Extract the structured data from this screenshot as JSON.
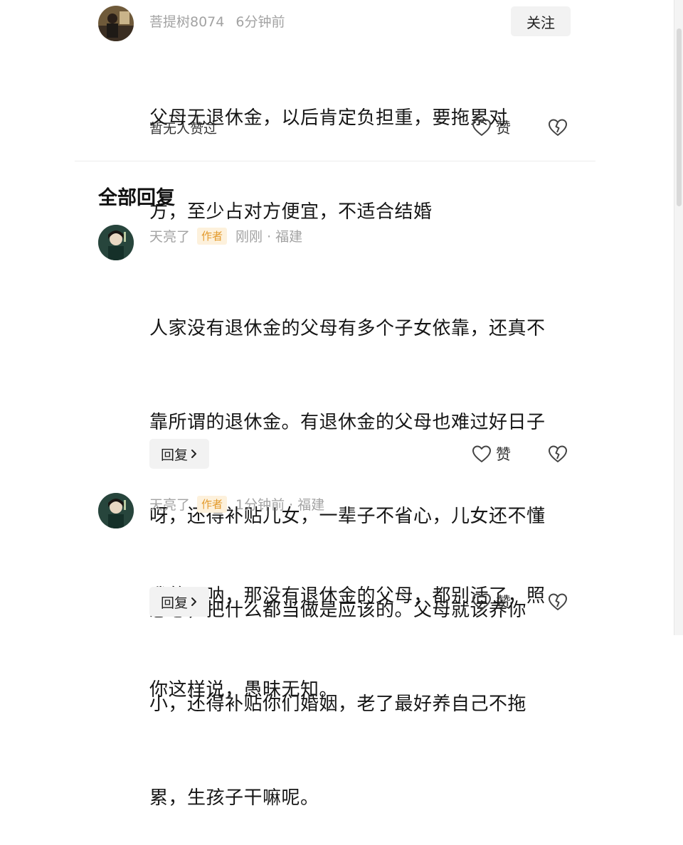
{
  "top_comment": {
    "username": "菩提树8074",
    "time": "6分钟前",
    "follow_label": "关注",
    "lines": [
      "父母无退休金，以后肯定负担重，要拖累对",
      "方，至少占对方便宜，不适合结婚"
    ],
    "no_likes_text": "暂无人赞过",
    "like_label": "赞"
  },
  "section": {
    "title": "全部回复"
  },
  "replies": [
    {
      "username": "天亮了",
      "author_tag": "作者",
      "time_location": "刚刚 · 福建",
      "lines": [
        "人家没有退休金的父母有多个子女依靠，还真不",
        "靠所谓的退休金。有退休金的父母也难过好日子",
        "呀，还得补贴儿女，一辈子不省心，儿女还不懂",
        "感恩，把什么都当做是应该的。父母就该养你",
        "小，还得补贴你们婚姻，老了最好养自己不拖",
        "累，生孩子干嘛呢。"
      ],
      "reply_label": "回复",
      "like_label": "赞"
    },
    {
      "username": "天亮了",
      "author_tag": "作者",
      "time_location": "1分钟前 · 福建",
      "lines": [
        "我的天呐，那没有退休金的父母，都别活了，照",
        "你这样说，愚昧无知。"
      ],
      "reply_label": "回复",
      "like_label": "赞"
    }
  ],
  "icons": {
    "heart": "heart-outline-icon",
    "dislike": "broken-heart-icon",
    "chevron": "chevron-right-icon"
  },
  "colors": {
    "meta_gray": "#a3a3a3",
    "author_tag_bg": "#fdf1dc",
    "author_tag_text": "#e39a2c",
    "button_bg": "#f2f2f2"
  }
}
